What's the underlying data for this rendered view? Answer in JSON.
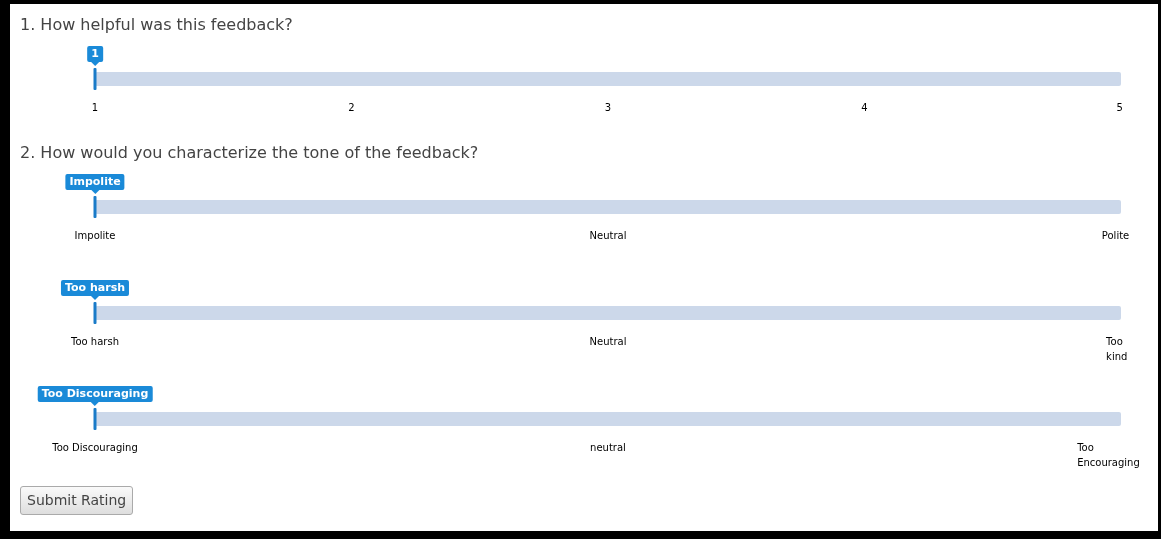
{
  "questions": [
    {
      "title": "1. How helpful was this feedback?",
      "sliders": [
        {
          "level": 0,
          "value_label": "1",
          "scale_labels": [
            "1",
            "2",
            "3",
            "4",
            "5"
          ]
        }
      ]
    },
    {
      "title": "2. How would you characterize the tone of the feedback?",
      "sliders": [
        {
          "level": 0,
          "value_label": "Impolite",
          "scale_labels": [
            "Impolite",
            "Neutral",
            "Polite"
          ]
        },
        {
          "level": 0,
          "value_label": "Too harsh",
          "scale_labels": [
            "Too harsh",
            "Neutral",
            "Too kind"
          ]
        },
        {
          "level": 0,
          "value_label": "Too Discouraging",
          "scale_labels": [
            "Too Discouraging",
            "neutral",
            "Too Encouraging"
          ]
        }
      ]
    }
  ],
  "submit_button": "Submit Rating"
}
